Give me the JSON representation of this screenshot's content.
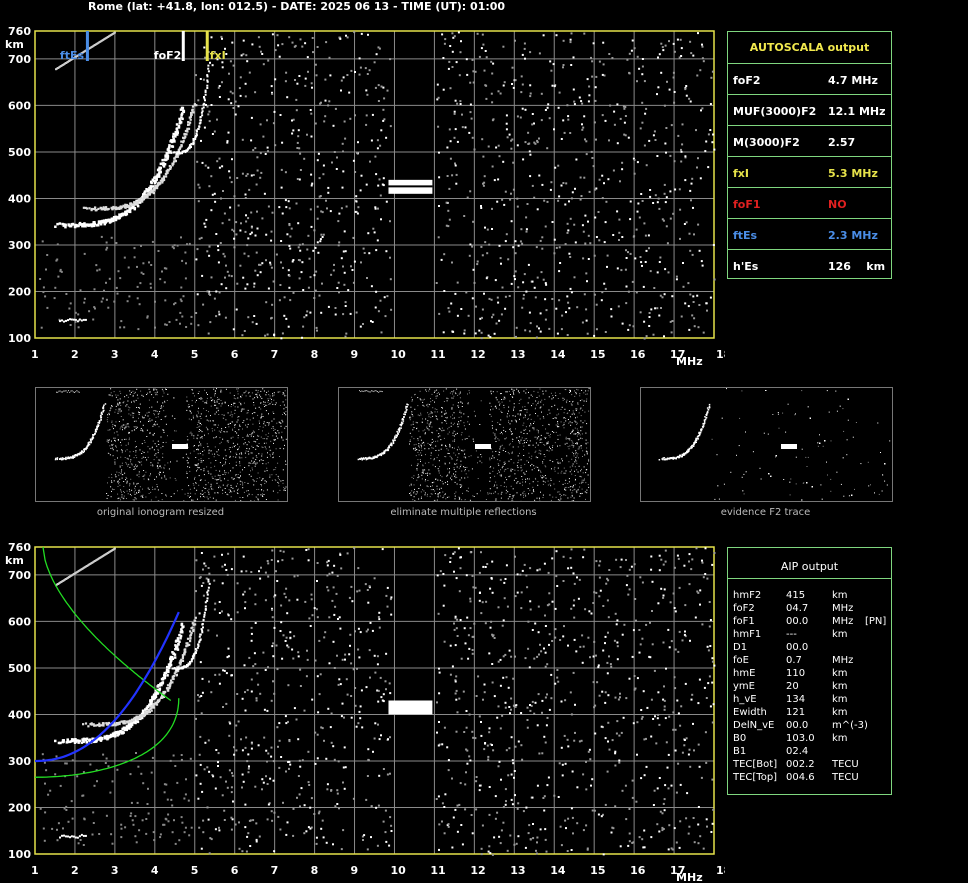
{
  "header": "Rome (lat: +41.8, lon: 012.5) - DATE: 2025 06 13 - TIME (UT): 01:00",
  "colors": {
    "axis": "#e6e24a",
    "grid": "#8a8a8a",
    "panel_border": "#7fd67f",
    "fof2": "#ffffff",
    "fxi": "#e6e24a",
    "ftes": "#4a8de6",
    "fof1": "#e02020",
    "green_curve": "#22dd22",
    "blue_curve": "#2233ff"
  },
  "chart_data": [
    {
      "type": "scatter",
      "name": "top-ionogram",
      "x_ticks": [
        1,
        2,
        3,
        4,
        5,
        6,
        7,
        8,
        9,
        10,
        11,
        12,
        13,
        14,
        15,
        16,
        17,
        18
      ],
      "y_ticks": [
        100,
        200,
        300,
        400,
        500,
        600,
        700,
        760
      ],
      "xlim": [
        1,
        18
      ],
      "ylim": [
        100,
        760
      ],
      "xunit": "MHz",
      "yunit": "km",
      "grid": true,
      "markers": [
        {
          "label": "ftEs",
          "x": 2.3,
          "color": "#4a8de6"
        },
        {
          "label": "foF2",
          "x": 4.7,
          "color": "#ffffff"
        },
        {
          "label": "fxI",
          "x": 5.3,
          "color": "#e6e24a"
        }
      ]
    },
    {
      "type": "scatter",
      "name": "bottom-ionogram",
      "x_ticks": [
        1,
        2,
        3,
        4,
        5,
        6,
        7,
        8,
        9,
        10,
        11,
        12,
        13,
        14,
        15,
        16,
        17,
        18
      ],
      "y_ticks": [
        100,
        200,
        300,
        400,
        500,
        600,
        700,
        760
      ],
      "xlim": [
        1,
        18
      ],
      "ylim": [
        100,
        760
      ],
      "xunit": "MHz",
      "yunit": "km",
      "grid": true
    }
  ],
  "autoscala": {
    "title": "AUTOSCALA output",
    "rows": [
      {
        "label": "foF2",
        "value": "4.7 MHz",
        "color": "#ffffff"
      },
      {
        "label": "MUF(3000)F2",
        "value": "12.1 MHz",
        "color": "#ffffff"
      },
      {
        "label": "M(3000)F2",
        "value": "2.57",
        "color": "#ffffff"
      },
      {
        "label": "fxI",
        "value": "5.3 MHz",
        "color": "#e6e24a"
      },
      {
        "label": "foF1",
        "value": "NO",
        "color": "#e02020"
      },
      {
        "label": "ftEs",
        "value": "2.3 MHz",
        "color": "#4a8de6"
      },
      {
        "label": "h'Es",
        "value": "126    km",
        "color": "#ffffff"
      }
    ]
  },
  "aip": {
    "title": "AIP output",
    "rows": [
      {
        "label": "hmF2",
        "value": "415",
        "unit": "km",
        "extra": ""
      },
      {
        "label": "foF2",
        "value": "04.7",
        "unit": "MHz",
        "extra": ""
      },
      {
        "label": "foF1",
        "value": "00.0",
        "unit": "MHz",
        "extra": "[PN]"
      },
      {
        "label": "hmF1",
        "value": "---",
        "unit": "km",
        "extra": ""
      },
      {
        "label": "D1",
        "value": "00.0",
        "unit": "",
        "extra": ""
      },
      {
        "label": "foE",
        "value": "0.7",
        "unit": "MHz",
        "extra": ""
      },
      {
        "label": "hmE",
        "value": "110",
        "unit": "km",
        "extra": ""
      },
      {
        "label": "ymE",
        "value": "20",
        "unit": "km",
        "extra": ""
      },
      {
        "label": "h_vE",
        "value": "134",
        "unit": "km",
        "extra": ""
      },
      {
        "label": "Ewidth",
        "value": "121",
        "unit": "km",
        "extra": ""
      },
      {
        "label": "DelN_vE",
        "value": "00.0",
        "unit": "m^(-3)",
        "extra": ""
      },
      {
        "label": "B0",
        "value": "103.0",
        "unit": "km",
        "extra": ""
      },
      {
        "label": "B1",
        "value": "02.4",
        "unit": "",
        "extra": ""
      },
      {
        "label": "TEC[Bot]",
        "value": "002.2",
        "unit": "TECU",
        "extra": ""
      },
      {
        "label": "TEC[Top]",
        "value": "004.6",
        "unit": "TECU",
        "extra": ""
      }
    ]
  },
  "thumbnails": [
    {
      "caption": "original ionogram resized"
    },
    {
      "caption": "eliminate multiple reflections"
    },
    {
      "caption": "evidence F2 trace"
    }
  ]
}
